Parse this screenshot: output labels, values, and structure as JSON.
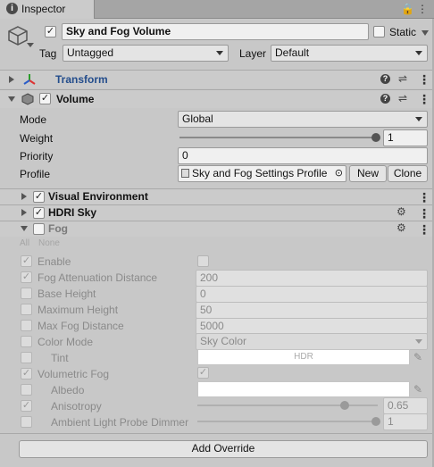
{
  "tab": {
    "title": "Inspector"
  },
  "gameobject": {
    "name": "Sky and Fog Volume",
    "static_label": "Static",
    "tag_label": "Tag",
    "tag_value": "Untagged",
    "layer_label": "Layer",
    "layer_value": "Default"
  },
  "components": {
    "transform": "Transform",
    "volume": "Volume"
  },
  "volume": {
    "mode_label": "Mode",
    "mode_value": "Global",
    "weight_label": "Weight",
    "weight_value": "1",
    "weight_fraction": 1.0,
    "priority_label": "Priority",
    "priority_value": "0",
    "profile_label": "Profile",
    "profile_value": "Sky and Fog Settings Profile",
    "new_label": "New",
    "clone_label": "Clone"
  },
  "overrides": {
    "visual_env": "Visual Environment",
    "hdri_sky": "HDRI Sky",
    "fog": "Fog",
    "all": "All",
    "none": "None"
  },
  "fog": {
    "enable": "Enable",
    "attenuation_label": "Fog Attenuation Distance",
    "attenuation_value": "200",
    "base_height_label": "Base Height",
    "base_height_value": "0",
    "max_height_label": "Maximum Height",
    "max_height_value": "50",
    "max_distance_label": "Max Fog Distance",
    "max_distance_value": "5000",
    "color_mode_label": "Color Mode",
    "color_mode_value": "Sky Color",
    "tint_label": "Tint",
    "tint_value": "HDR",
    "volumetric_label": "Volumetric Fog",
    "albedo_label": "Albedo",
    "anisotropy_label": "Anisotropy",
    "anisotropy_value": "0.65",
    "anisotropy_fraction": 0.65,
    "ambient_probe_label": "Ambient Light Probe Dimmer",
    "ambient_probe_value": "1",
    "ambient_probe_fraction": 1.0
  },
  "add_override": "Add Override"
}
